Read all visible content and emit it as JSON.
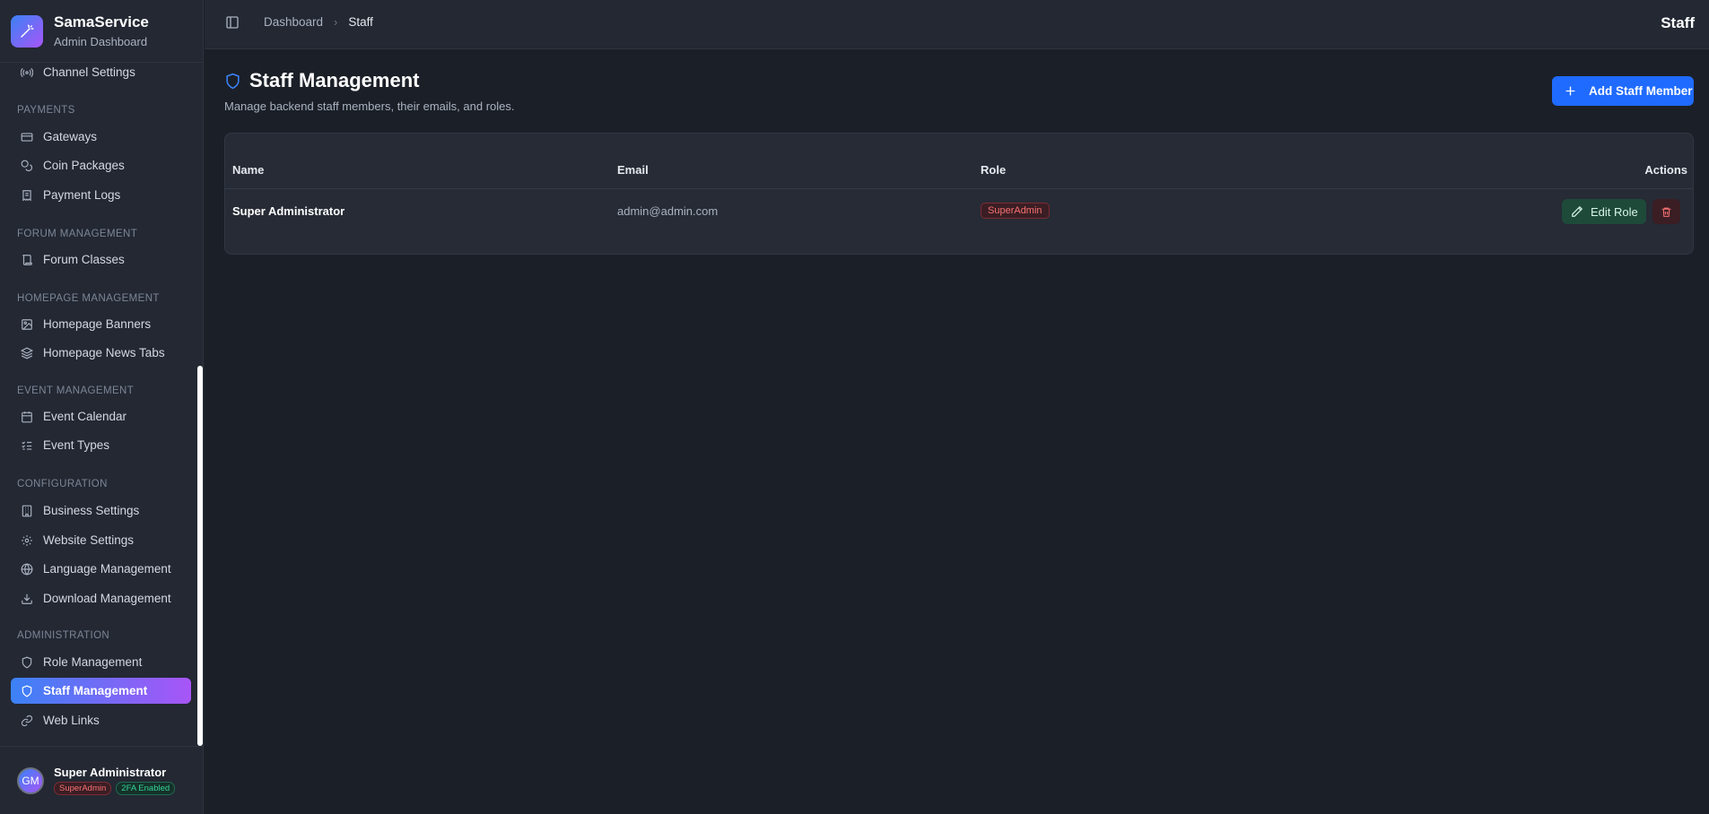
{
  "brand": {
    "title": "SamaService",
    "subtitle": "Admin Dashboard"
  },
  "sidebar": {
    "items": [
      {
        "label": "Channel Settings",
        "icon": "broadcast-icon"
      },
      {
        "section": "PAYMENTS"
      },
      {
        "label": "Gateways",
        "icon": "credit-card-icon"
      },
      {
        "label": "Coin Packages",
        "icon": "coins-icon"
      },
      {
        "label": "Payment Logs",
        "icon": "receipt-icon"
      },
      {
        "section": "FORUM MANAGEMENT"
      },
      {
        "label": "Forum Classes",
        "icon": "scroll-icon"
      },
      {
        "section": "HOMEPAGE MANAGEMENT"
      },
      {
        "label": "Homepage Banners",
        "icon": "image-icon"
      },
      {
        "label": "Homepage News Tabs",
        "icon": "layers-icon"
      },
      {
        "section": "EVENT MANAGEMENT"
      },
      {
        "label": "Event Calendar",
        "icon": "calendar-icon"
      },
      {
        "label": "Event Types",
        "icon": "list-checks-icon"
      },
      {
        "section": "CONFIGURATION"
      },
      {
        "label": "Business Settings",
        "icon": "building-icon"
      },
      {
        "label": "Website Settings",
        "icon": "gear-icon"
      },
      {
        "label": "Language Management",
        "icon": "globe-icon"
      },
      {
        "label": "Download Management",
        "icon": "download-icon"
      },
      {
        "section": "ADMINISTRATION"
      },
      {
        "label": "Role Management",
        "icon": "shield-icon"
      },
      {
        "label": "Staff Management",
        "icon": "shield-icon",
        "active": true
      },
      {
        "label": "Web Links",
        "icon": "link-icon"
      }
    ]
  },
  "user": {
    "initials": "GM",
    "name": "Super Administrator",
    "role_badge": "SuperAdmin",
    "twofa_badge": "2FA Enabled"
  },
  "topbar": {
    "crumbs": [
      "Dashboard",
      "Staff"
    ],
    "title": "Staff"
  },
  "page": {
    "title": "Staff Management",
    "description": "Manage backend staff members, their emails, and roles.",
    "add_button": "Add Staff Member"
  },
  "table": {
    "headers": [
      "Name",
      "Email",
      "Role",
      "Actions"
    ],
    "rows": [
      {
        "name": "Super Administrator",
        "email": "admin@admin.com",
        "role": "SuperAdmin",
        "edit_label": "Edit Role"
      }
    ]
  },
  "colors": {
    "accent_start": "#3b82f6",
    "accent_end": "#a855f7",
    "primary_button": "#1f6bff",
    "danger": "#f87171"
  }
}
